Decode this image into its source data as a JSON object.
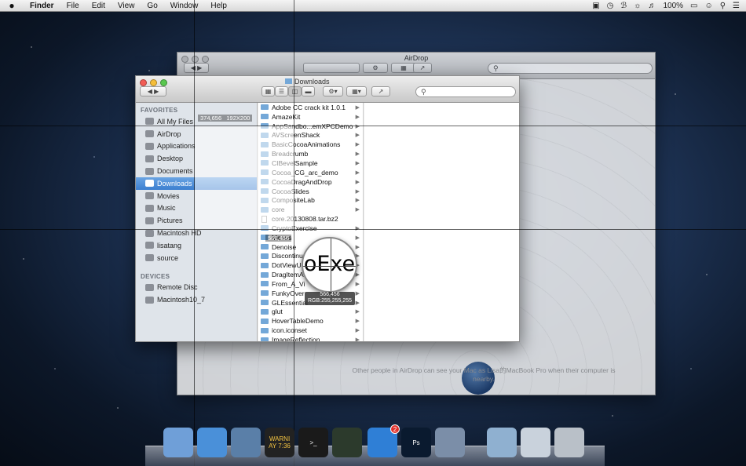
{
  "menubar": {
    "apple": "",
    "items": [
      "Finder",
      "File",
      "Edit",
      "View",
      "Go",
      "Window",
      "Help"
    ],
    "battery": "100%",
    "status_icons": [
      "camera-icon",
      "time-machine-icon",
      "bluetooth-icon",
      "wifi-icon",
      "volume-icon",
      "battery-icon",
      "user-icon",
      "search-icon",
      "list-icon"
    ]
  },
  "airdrop_window": {
    "title": "AirDrop",
    "message": "Other people in AirDrop can see your Mac as Lisa的MacBook Pro when their computer is nearby."
  },
  "downloads_window": {
    "title": "Downloads",
    "sidebar": {
      "favorites_header": "FAVORITES",
      "favorites": [
        {
          "label": "All My Files",
          "icon": "files-icon"
        },
        {
          "label": "AirDrop",
          "icon": "airdrop-icon"
        },
        {
          "label": "Applications",
          "icon": "applications-icon"
        },
        {
          "label": "Desktop",
          "icon": "desktop-icon"
        },
        {
          "label": "Documents",
          "icon": "documents-icon"
        },
        {
          "label": "Downloads",
          "icon": "downloads-icon",
          "selected": true
        },
        {
          "label": "Movies",
          "icon": "movies-icon"
        },
        {
          "label": "Music",
          "icon": "music-icon"
        },
        {
          "label": "Pictures",
          "icon": "pictures-icon"
        },
        {
          "label": "Macintosh HD",
          "icon": "hd-icon"
        },
        {
          "label": "lisatang",
          "icon": "home-icon"
        },
        {
          "label": "source",
          "icon": "folder-icon"
        }
      ],
      "devices_header": "DEVICES",
      "devices": [
        {
          "label": "Remote Disc",
          "icon": "disc-icon"
        },
        {
          "label": "Macintosh10_7",
          "icon": "hd-icon"
        }
      ]
    },
    "files": [
      "Adobe CC crack kit 1.0.1",
      "AmazeKit",
      "AppSandbo...emXPCDemo",
      "AVScreenShack",
      "BasicCocoaAnimations",
      "Breadcrumb",
      "CIBevelSample",
      "Cocoa_CG_arc_demo",
      "CocoaDragAndDrop",
      "CocoaSlides",
      "CompositeLab",
      "core",
      "core.20130808.tar.bz2",
      "CryptoExercise",
      "Menus",
      "Denoise",
      "Discontinu",
      "DotViewU",
      "DragItemA",
      "From_A_Vi",
      "FunkyOver",
      "GLEssential",
      "glut",
      "HoverTableDemo",
      "icon.iconset",
      "ImageReflection"
    ]
  },
  "capture_overlay": {
    "selection_origin": "374,656",
    "selection_size": "192X200",
    "cursor_coords": "566,456",
    "loupe_coords": "566,456",
    "loupe_rgb": "RGB:255,255,255",
    "loupe_text": "oExe"
  },
  "dock": {
    "items": [
      {
        "name": "finder-icon",
        "color": "#6f9fd8"
      },
      {
        "name": "safari-icon",
        "color": "#4a90d9"
      },
      {
        "name": "xcode-icon",
        "color": "#5a7fa8"
      },
      {
        "name": "console-icon",
        "color": "#222222",
        "label": "WARNI AY 7:36"
      },
      {
        "name": "terminal-icon",
        "color": "#1a1a1a",
        "label": ">_"
      },
      {
        "name": "activity-monitor-icon",
        "color": "#2c3a2c"
      },
      {
        "name": "app-store-icon",
        "color": "#2f7fd6",
        "badge": "2"
      },
      {
        "name": "photoshop-icon",
        "color": "#0a1a2f",
        "label": "Ps"
      },
      {
        "name": "preview-icon",
        "color": "#7b8ea8"
      },
      {
        "name": "downloads-stack-icon",
        "color": "#8fb0d0"
      },
      {
        "name": "documents-stack-icon",
        "color": "#c9d2dc"
      },
      {
        "name": "trash-icon",
        "color": "#b9c0c8"
      }
    ]
  }
}
